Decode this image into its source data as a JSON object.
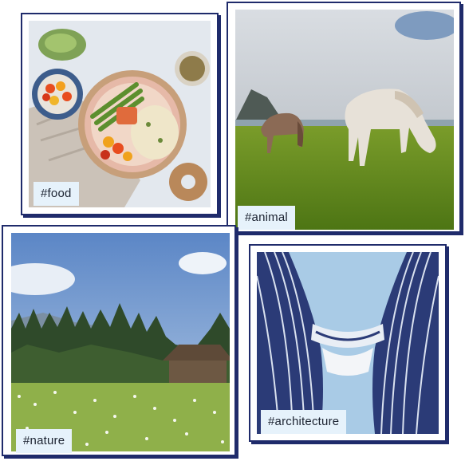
{
  "gallery": {
    "cards": [
      {
        "tag": "#food",
        "subject": "food-photo"
      },
      {
        "tag": "#animal",
        "subject": "animal-photo"
      },
      {
        "tag": "#nature",
        "subject": "nature-photo"
      },
      {
        "tag": "#architecture",
        "subject": "architecture-photo"
      }
    ]
  },
  "colors": {
    "border": "#1f2b6b",
    "tag_background": "#e6f2fb",
    "tag_text": "#1b2230"
  }
}
